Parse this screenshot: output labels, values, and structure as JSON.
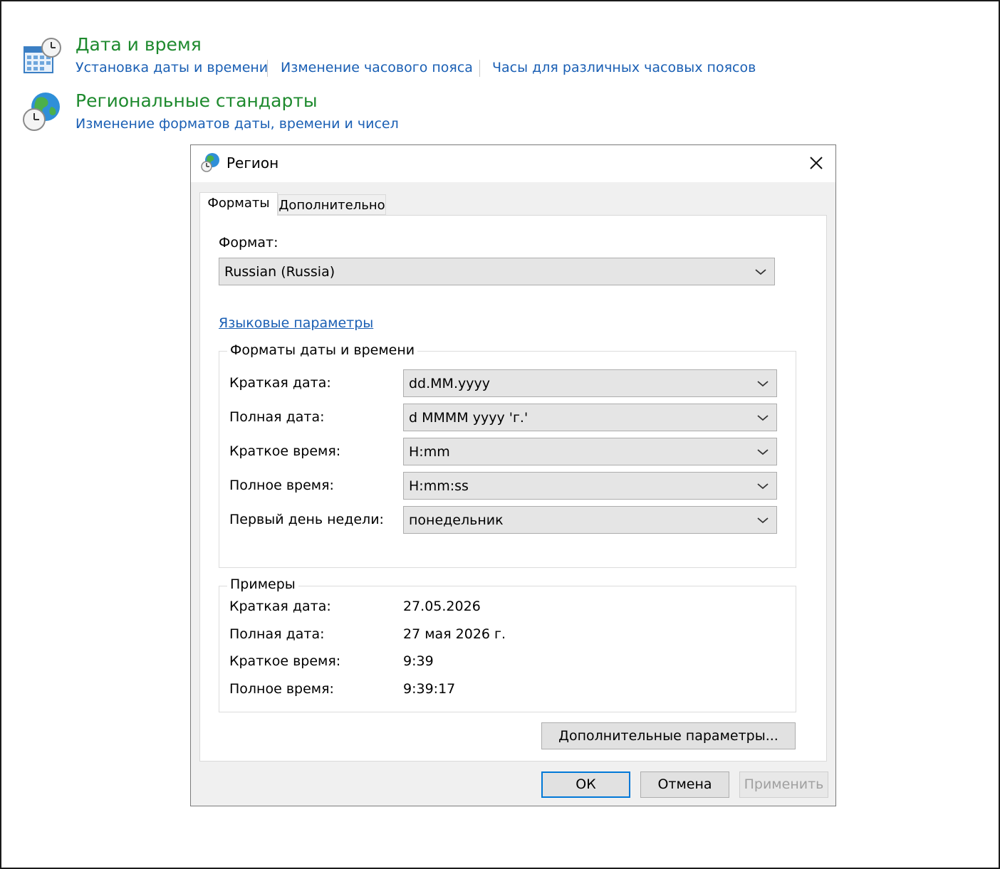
{
  "control_panel": {
    "datetime": {
      "title": "Дата и время",
      "links": [
        "Установка даты и времени",
        "Изменение часового пояса",
        "Часы для различных часовых поясов"
      ]
    },
    "region": {
      "title": "Региональные стандарты",
      "links": [
        "Изменение форматов даты, времени и чисел"
      ]
    }
  },
  "dialog": {
    "title": "Регион",
    "tabs": [
      {
        "label": "Форматы",
        "active": true
      },
      {
        "label": "Дополнительно",
        "active": false
      }
    ],
    "format_label": "Формат:",
    "format_value": "Russian (Russia)",
    "language_link": "Языковые параметры",
    "formats_group": {
      "title": "Форматы даты и времени",
      "rows": [
        {
          "label": "Краткая дата:",
          "value": "dd.MM.yyyy"
        },
        {
          "label": "Полная дата:",
          "value": "d MMMM yyyy 'г.'"
        },
        {
          "label": "Краткое время:",
          "value": "H:mm"
        },
        {
          "label": "Полное время:",
          "value": "H:mm:ss"
        },
        {
          "label": "Первый день недели:",
          "value": "понедельник"
        }
      ]
    },
    "examples_group": {
      "title": "Примеры",
      "rows": [
        {
          "label": "Краткая дата:",
          "value": "27.05.2026"
        },
        {
          "label": "Полная дата:",
          "value": "27 мая 2026 г."
        },
        {
          "label": "Краткое время:",
          "value": "9:39"
        },
        {
          "label": "Полное время:",
          "value": "9:39:17"
        }
      ]
    },
    "advanced_button": "Дополнительные параметры...",
    "buttons": {
      "ok": "ОК",
      "cancel": "Отмена",
      "apply": "Применить"
    }
  },
  "icons": {
    "datetime": "calendar-clock-icon",
    "region": "globe-clock-icon",
    "dialog": "globe-icon",
    "close": "close-icon",
    "dropdown": "chevron-down-icon"
  },
  "colors": {
    "title_green": "#1e8a2e",
    "link_blue": "#1a5fb4",
    "accent": "#0078d7"
  }
}
